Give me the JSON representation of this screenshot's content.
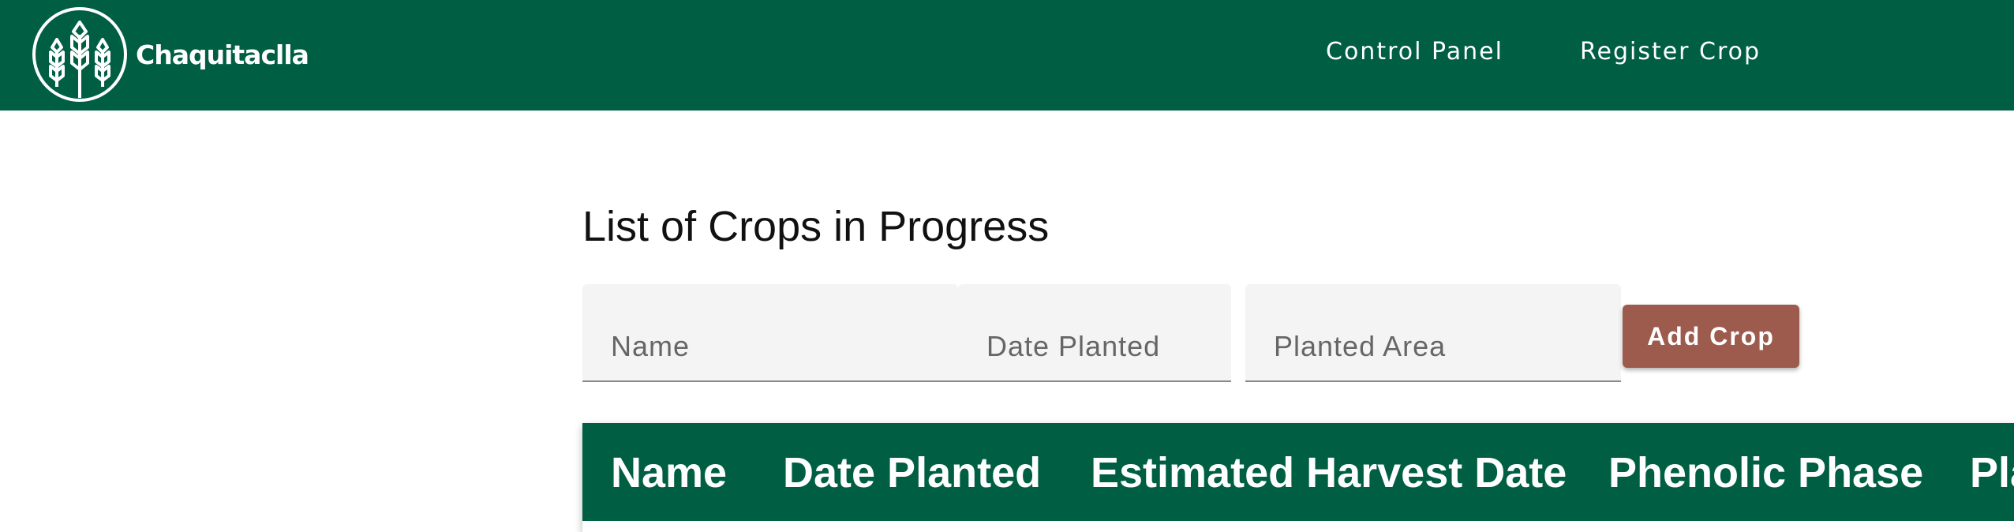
{
  "brand": {
    "name": "Chaquitaclla",
    "logo_icon": "wheat-icon"
  },
  "nav": {
    "control_panel": "Control Panel",
    "register_crop": "Register Crop"
  },
  "page": {
    "title": "List of Crops in Progress"
  },
  "form": {
    "name_placeholder": "Name",
    "date_placeholder": "Date Planted",
    "area_placeholder": "Planted Area",
    "add_button": "Add Crop"
  },
  "table": {
    "headers": [
      "Name",
      "Date Planted",
      "Estimated Harvest Date",
      "Phenolic Phase",
      "Planted Area"
    ]
  },
  "colors": {
    "primary": "#005f43",
    "accent": "#9c5b4d",
    "input_bg": "#f4f4f4"
  }
}
